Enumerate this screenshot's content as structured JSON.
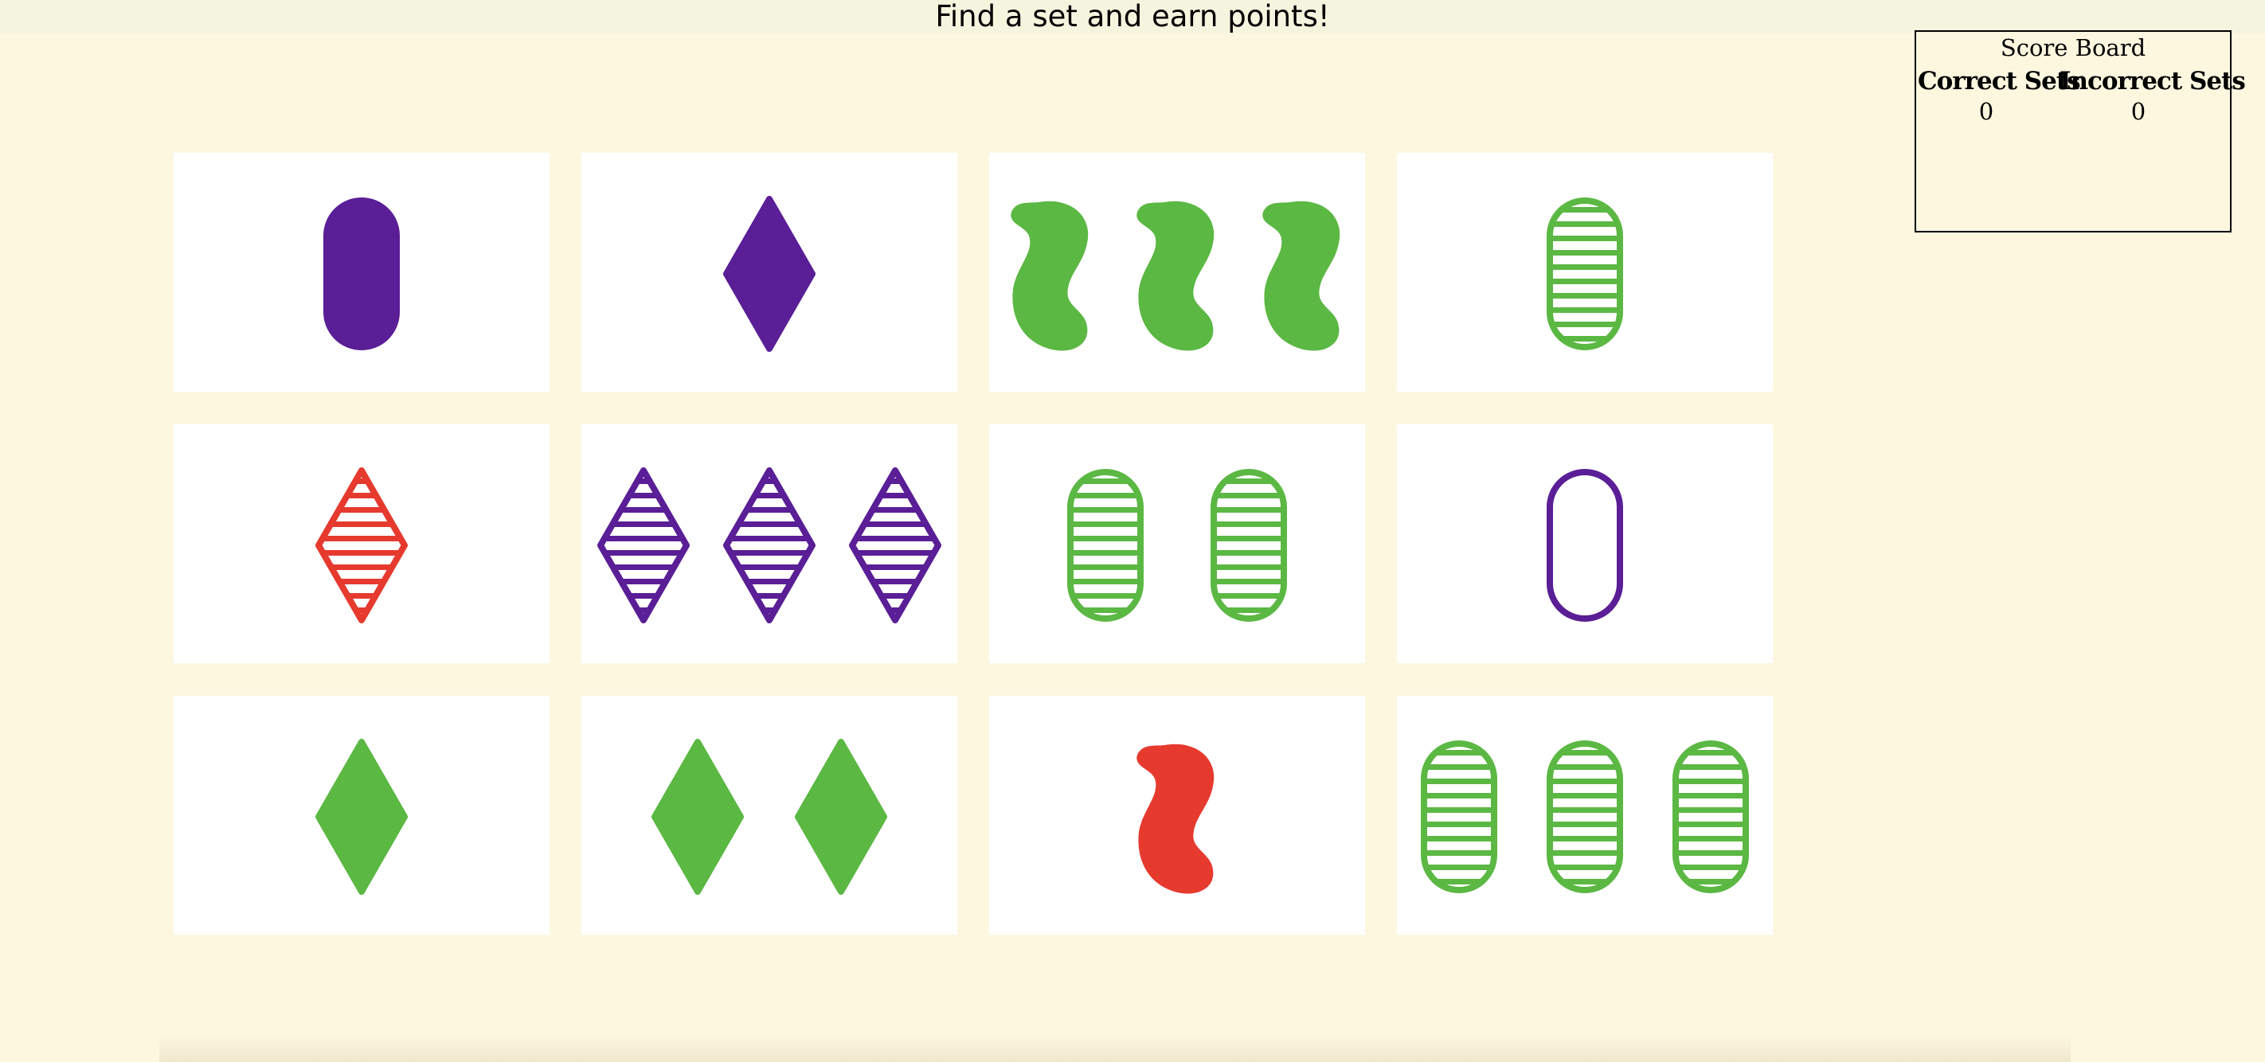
{
  "header": {
    "title": "Find a set and earn points!"
  },
  "scoreboard": {
    "title": "Score Board",
    "correct_label": "Correct Sets",
    "incorrect_label": "Incorrect Sets",
    "correct_value": "0",
    "incorrect_value": "0"
  },
  "colors": {
    "purple": "#5a1e96",
    "green": "#5bb843",
    "red": "#e63a2e",
    "background": "#fdf7e0",
    "banner": "#f5f5df"
  },
  "cards": [
    {
      "count": 1,
      "shape": "oval",
      "color": "purple",
      "fill": "solid"
    },
    {
      "count": 1,
      "shape": "diamond",
      "color": "purple",
      "fill": "solid"
    },
    {
      "count": 3,
      "shape": "squiggle",
      "color": "green",
      "fill": "solid"
    },
    {
      "count": 1,
      "shape": "oval",
      "color": "green",
      "fill": "striped"
    },
    {
      "count": 1,
      "shape": "diamond",
      "color": "red",
      "fill": "striped"
    },
    {
      "count": 3,
      "shape": "diamond",
      "color": "purple",
      "fill": "striped"
    },
    {
      "count": 2,
      "shape": "oval",
      "color": "green",
      "fill": "striped"
    },
    {
      "count": 1,
      "shape": "oval",
      "color": "purple",
      "fill": "outline"
    },
    {
      "count": 1,
      "shape": "diamond",
      "color": "green",
      "fill": "solid"
    },
    {
      "count": 2,
      "shape": "diamond",
      "color": "green",
      "fill": "solid"
    },
    {
      "count": 1,
      "shape": "squiggle",
      "color": "red",
      "fill": "solid"
    },
    {
      "count": 3,
      "shape": "oval",
      "color": "green",
      "fill": "striped"
    }
  ]
}
